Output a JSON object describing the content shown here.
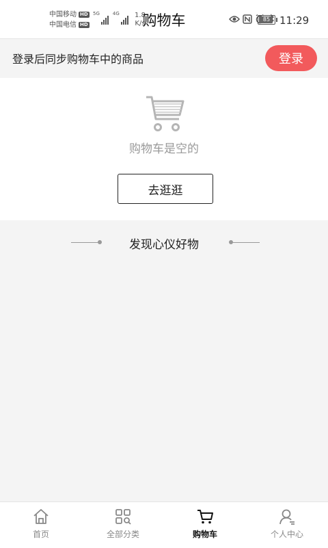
{
  "status_bar": {
    "carrier_1": "中国移动",
    "carrier_2": "中国电信",
    "hd_badge": "HD",
    "network_1": "5G",
    "network_2": "4G",
    "speed_value": "1.8",
    "speed_unit": "K/s",
    "battery_level": "85",
    "time": "11:29",
    "icons": [
      "eye-icon",
      "nfc-icon",
      "alarm-icon",
      "bluetooth-icon",
      "battery-icon"
    ]
  },
  "header": {
    "title": "购物车"
  },
  "login_banner": {
    "text": "登录后同步购物车中的商品",
    "button_label": "登录"
  },
  "empty_cart": {
    "icon": "shopping-cart-icon",
    "message": "购物车是空的",
    "button_label": "去逛逛"
  },
  "discover": {
    "title": "发现心仪好物"
  },
  "tabbar": {
    "tabs": [
      {
        "label": "首页",
        "icon": "home-icon",
        "active": false
      },
      {
        "label": "全部分类",
        "icon": "category-search-icon",
        "active": false
      },
      {
        "label": "购物车",
        "icon": "cart-icon",
        "active": true
      },
      {
        "label": "个人中心",
        "icon": "user-icon",
        "active": false
      }
    ]
  },
  "colors": {
    "accent": "#f25a5c",
    "background": "#f4f4f4",
    "muted_text": "#9a9a9a"
  }
}
